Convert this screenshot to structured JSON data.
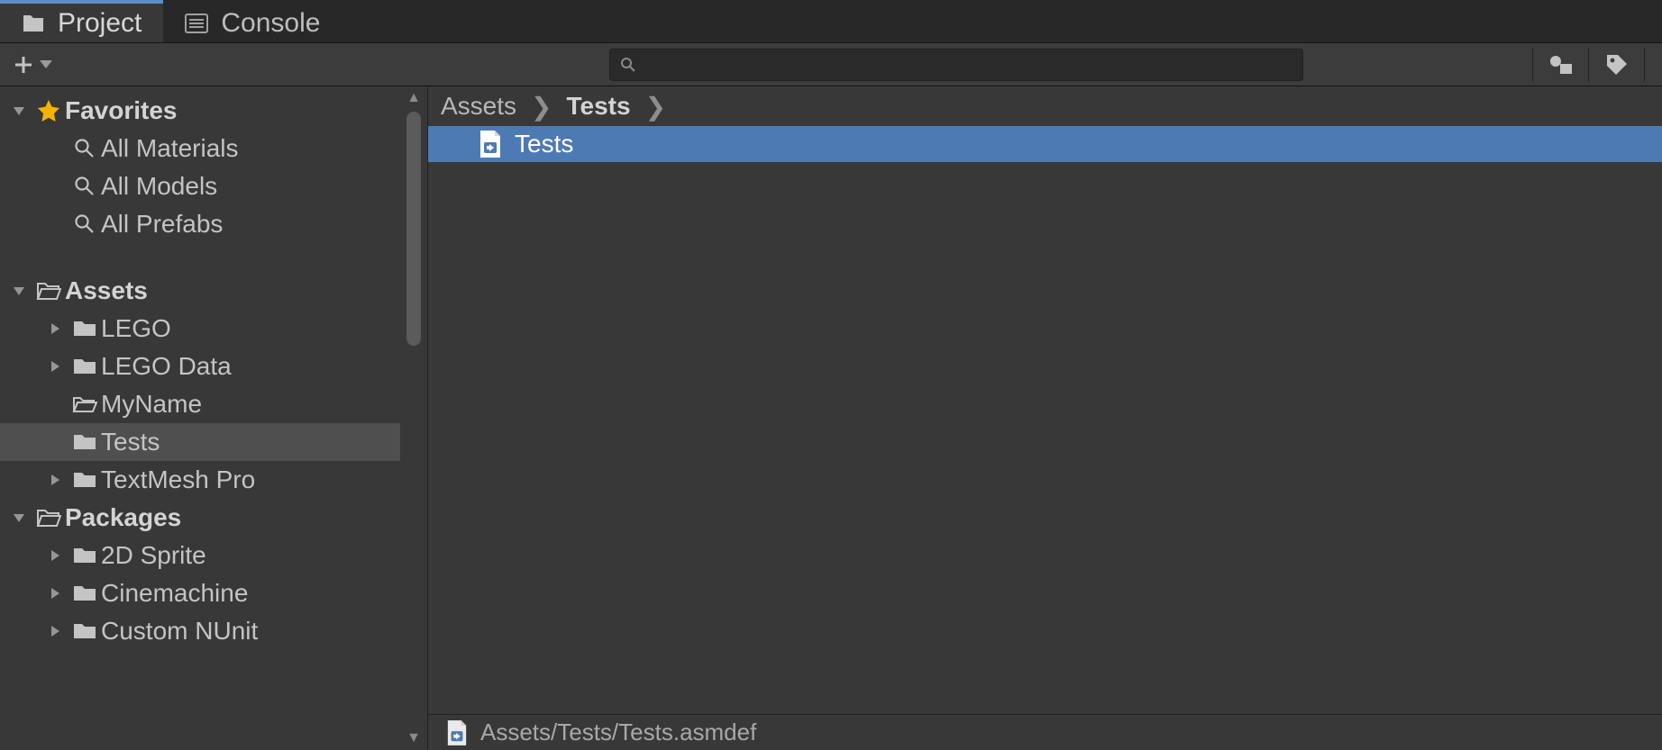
{
  "tabs": {
    "project": "Project",
    "console": "Console"
  },
  "search": {
    "placeholder": ""
  },
  "sidebar": {
    "favorites": {
      "label": "Favorites",
      "items": [
        "All Materials",
        "All Models",
        "All Prefabs"
      ]
    },
    "assets": {
      "label": "Assets",
      "items": [
        {
          "label": "LEGO",
          "expandable": true
        },
        {
          "label": "LEGO Data",
          "expandable": true
        },
        {
          "label": "MyName",
          "expandable": false
        },
        {
          "label": "Tests",
          "expandable": false,
          "selected": true
        },
        {
          "label": "TextMesh Pro",
          "expandable": true
        }
      ]
    },
    "packages": {
      "label": "Packages",
      "items": [
        {
          "label": "2D Sprite",
          "expandable": true
        },
        {
          "label": "Cinemachine",
          "expandable": true
        },
        {
          "label": "Custom NUnit",
          "expandable": true
        }
      ]
    }
  },
  "breadcrumb": [
    "Assets",
    "Tests"
  ],
  "files": [
    {
      "label": "Tests",
      "selected": true
    }
  ],
  "status_path": "Assets/Tests/Tests.asmdef"
}
